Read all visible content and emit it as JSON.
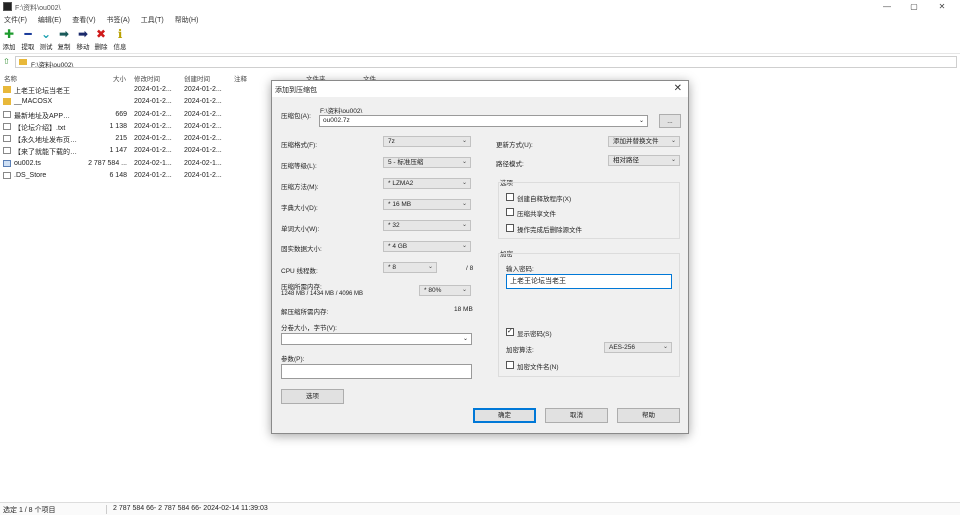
{
  "window": {
    "title": "F:\\资料\\ou002\\",
    "controls": {
      "minimize": "—",
      "maximize": "▢",
      "close": "✕"
    }
  },
  "menu": [
    "文件(F)",
    "编辑(E)",
    "查看(V)",
    "书签(A)",
    "工具(T)",
    "帮助(H)"
  ],
  "toolbar": [
    {
      "label": "添加",
      "icon": "plus-icon",
      "glyph": "✚",
      "color": "#1e9b2e"
    },
    {
      "label": "提取",
      "icon": "minus-icon",
      "glyph": "━",
      "color": "#1a3c9b"
    },
    {
      "label": "测试",
      "icon": "check-arrow-icon",
      "glyph": "⌄",
      "color": "#1aa0b0"
    },
    {
      "label": "复制",
      "icon": "copy-arrow-icon",
      "glyph": "➡",
      "color": "#1a5a5a"
    },
    {
      "label": "移动",
      "icon": "move-arrow-icon",
      "glyph": "➡",
      "color": "#1a2a6b"
    },
    {
      "label": "删除",
      "icon": "delete-x-icon",
      "glyph": "✖",
      "color": "#d01a1a"
    },
    {
      "label": "信息",
      "icon": "info-icon",
      "glyph": "ℹ",
      "color": "#b8a000"
    }
  ],
  "address": {
    "path": "F:\\资料\\ou002\\"
  },
  "columns": [
    "名称",
    "大小",
    "修改时间",
    "创建时间",
    "注释",
    "文件夹",
    "文件"
  ],
  "files": [
    {
      "type": "folder",
      "name": "上老王论坛当老王",
      "size": "",
      "modified": "2024-01-2...",
      "created": "2024-01-2..."
    },
    {
      "type": "folder",
      "name": "__MACOSX",
      "size": "",
      "modified": "2024-01-2...",
      "created": "2024-01-2..."
    },
    {
      "type": "file",
      "name": "最新地址及APP…",
      "size": "669",
      "modified": "2024-01-2...",
      "created": "2024-01-2..."
    },
    {
      "type": "file",
      "name": "【论坛介绍】.txt",
      "size": "1 138",
      "modified": "2024-01-2...",
      "created": "2024-01-2..."
    },
    {
      "type": "file",
      "name": "【永久地址发布页…",
      "size": "215",
      "modified": "2024-01-2...",
      "created": "2024-01-2..."
    },
    {
      "type": "file",
      "name": "【来了就能下载的…",
      "size": "1 147",
      "modified": "2024-01-2...",
      "created": "2024-01-2..."
    },
    {
      "type": "ts",
      "name": "ou002.ts",
      "size": "2 787 584 ...",
      "modified": "2024-02-1...",
      "created": "2024-02-1..."
    },
    {
      "type": "file",
      "name": ".DS_Store",
      "size": "6 148",
      "modified": "2024-01-2...",
      "created": "2024-01-2..."
    }
  ],
  "status": {
    "selection": "选定 1 / 8 个项目",
    "info": "2 787 584 66- 2 787 584 66- 2024-02-14 11:39:03"
  },
  "dialog": {
    "title": "添加到压缩包",
    "close": "✕",
    "archive_label": "压缩包(A):",
    "archive_dir": "F:\\资料\\ou002\\",
    "archive_name": "ou002.7z",
    "browse": "...",
    "format": {
      "label": "压缩格式(F):",
      "value": "7z"
    },
    "level": {
      "label": "压缩等级(L):",
      "value": "5 - 标准压缩"
    },
    "method": {
      "label": "压缩方法(M):",
      "value": "* LZMA2"
    },
    "dict": {
      "label": "字典大小(D):",
      "value": "* 16 MB"
    },
    "word": {
      "label": "单词大小(W):",
      "value": "* 32"
    },
    "solid": {
      "label": "固实数据大小:",
      "value": "* 4 GB"
    },
    "threads": {
      "label": "CPU 线程数:",
      "value": "* 8",
      "max": "/ 8"
    },
    "mem_comp": {
      "label": "压缩所需内存:",
      "detail": "1248 MB / 1434 MB / 4096 MB",
      "value": "* 80%"
    },
    "mem_decomp": {
      "label": "解压缩所需内存:",
      "value": "18 MB"
    },
    "split": {
      "label": "分卷大小，字节(V):",
      "value": ""
    },
    "params": {
      "label": "参数(P):",
      "value": ""
    },
    "options_button": "选项",
    "update": {
      "label": "更新方式(U):",
      "value": "添加并替换文件"
    },
    "pathmode": {
      "label": "路径模式:",
      "value": "相对路径"
    },
    "options_group": {
      "title": "选项",
      "items": [
        {
          "label": "创建自释放程序(X)",
          "checked": false
        },
        {
          "label": "压缩共享文件",
          "checked": false
        },
        {
          "label": "操作完成后删除源文件",
          "checked": false
        }
      ]
    },
    "encrypt_group": {
      "title": "加密",
      "password_label": "输入密码:",
      "password_value": "上老王论坛当老王",
      "show_password": {
        "label": "显示密码(S)",
        "checked": true
      },
      "method_label": "加密算法:",
      "method_value": "AES-256",
      "encrypt_names": {
        "label": "加密文件名(N)",
        "checked": false
      }
    },
    "ok": "确定",
    "cancel": "取消",
    "help": "帮助"
  }
}
